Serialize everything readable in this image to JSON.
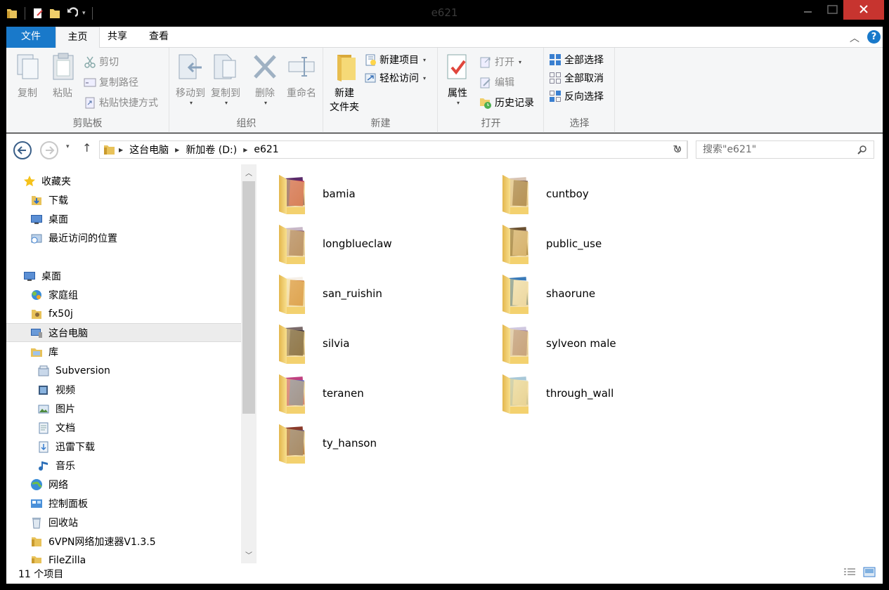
{
  "window": {
    "title": "e621"
  },
  "ribbon_tabs": {
    "file": "文件",
    "home": "主页",
    "share": "共享",
    "view": "查看"
  },
  "ribbon": {
    "clipboard": {
      "label": "剪贴板",
      "copy": "复制",
      "paste": "粘贴",
      "cut": "剪切",
      "copy_path": "复制路径",
      "paste_shortcut": "粘贴快捷方式"
    },
    "organize": {
      "label": "组织",
      "move_to": "移动到",
      "copy_to": "复制到",
      "delete": "删除",
      "rename": "重命名"
    },
    "new": {
      "label": "新建",
      "new_folder_line1": "新建",
      "new_folder_line2": "文件夹",
      "new_item": "新建项目",
      "easy_access": "轻松访问"
    },
    "open": {
      "label": "打开",
      "properties": "属性",
      "open": "打开",
      "edit": "编辑",
      "history": "历史记录"
    },
    "select": {
      "label": "选择",
      "select_all": "全部选择",
      "select_none": "全部取消",
      "invert": "反向选择"
    }
  },
  "address": {
    "crumbs": [
      "这台电脑",
      "新加卷 (D:)",
      "e621"
    ],
    "search_placeholder": "搜索\"e621\""
  },
  "nav": {
    "favorites": "收藏夹",
    "downloads": "下载",
    "desktop_fav": "桌面",
    "recent": "最近访问的位置",
    "desktop": "桌面",
    "homegroup": "家庭组",
    "user": "fx50j",
    "this_pc": "这台电脑",
    "libraries": "库",
    "subversion": "Subversion",
    "videos": "视频",
    "pictures": "图片",
    "documents": "文档",
    "xunlei": "迅雷下载",
    "music": "音乐",
    "network": "网络",
    "control_panel": "控制面板",
    "recycle_bin": "回收站",
    "vpn": "6VPN网络加速器V1.3.5",
    "filezilla": "FileZilla"
  },
  "folders": [
    {
      "name": "bamia"
    },
    {
      "name": "cuntboy"
    },
    {
      "name": "longblueclaw"
    },
    {
      "name": "public_use"
    },
    {
      "name": "san_ruishin"
    },
    {
      "name": "shaorune"
    },
    {
      "name": "silvia"
    },
    {
      "name": "sylveon male"
    },
    {
      "name": "teranen"
    },
    {
      "name": "through_wall"
    },
    {
      "name": "ty_hanson"
    }
  ],
  "status": {
    "count": "11 个项目"
  },
  "colors": {
    "accent": "#1979ca",
    "folder": "#f3d16f",
    "close": "#c7342f"
  }
}
